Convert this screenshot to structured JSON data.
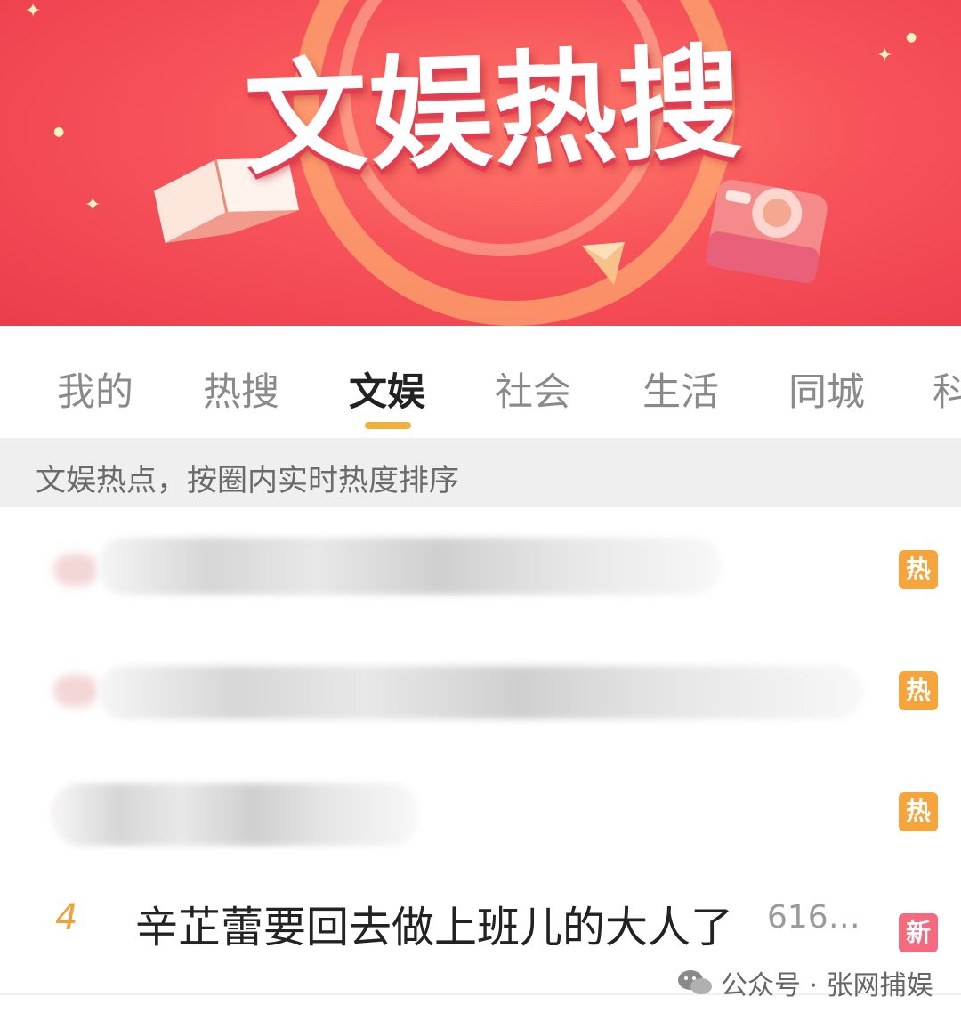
{
  "banner": {
    "title": "文娱热搜"
  },
  "tabs": [
    {
      "label": "我的"
    },
    {
      "label": "热搜"
    },
    {
      "label": "文娱",
      "active": true
    },
    {
      "label": "社会"
    },
    {
      "label": "生活"
    },
    {
      "label": "同城"
    },
    {
      "label": "科"
    }
  ],
  "hint": {
    "text": "文娱热点，按圈内实时热度排序"
  },
  "list": [
    {
      "badge": "热",
      "badge_color": "#f5a53b"
    },
    {
      "badge": "热",
      "badge_color": "#f5a53b"
    },
    {
      "badge": "热",
      "badge_color": "#f5a53b"
    },
    {
      "rank": "4",
      "title": "辛芷蕾要回去做上班儿的大人了",
      "heat": "616…",
      "badge": "新",
      "badge_color": "#f26b7f"
    }
  ],
  "watermark": {
    "text": "公众号 · 张网捕娱",
    "icon": "wechat-icon"
  },
  "colors": {
    "accent": "#f0b13c",
    "banner": "#f7535a",
    "hot_badge": "#f5a53b",
    "new_badge": "#f26b7f"
  }
}
